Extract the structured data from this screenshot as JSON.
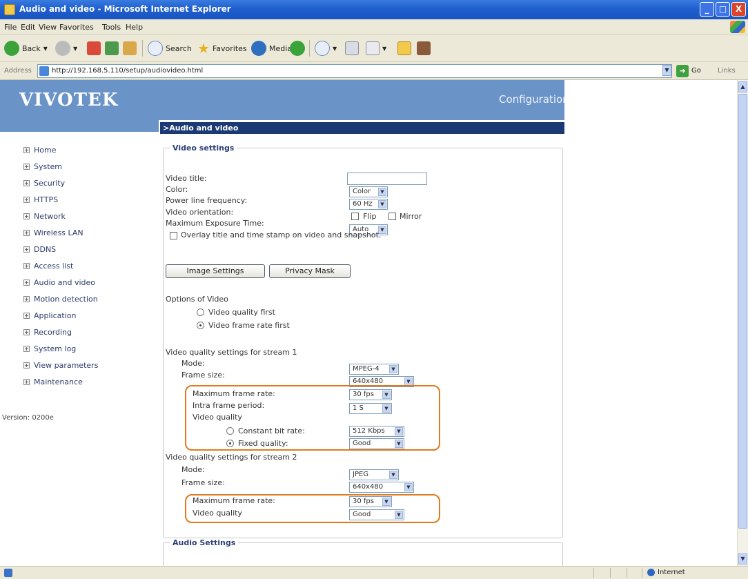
{
  "window": {
    "title": "Audio and video - Microsoft Internet Explorer",
    "min": "_",
    "max": "□",
    "close": "X"
  },
  "menu": [
    "File",
    "Edit",
    "View",
    "Favorites",
    "Tools",
    "Help"
  ],
  "toolbar": {
    "back": "Back",
    "search": "Search",
    "favorites": "Favorites",
    "media": "Media"
  },
  "address": {
    "label": "Address",
    "url": "http://192.168.5.110/setup/audiovideo.html",
    "go": "Go",
    "links": "Links"
  },
  "brand": {
    "logo": "VIVOTEK",
    "config": "Configuration"
  },
  "section_title": "Audio and video",
  "sidebar": {
    "items": [
      "Home",
      "System",
      "Security",
      "HTTPS",
      "Network",
      "Wireless LAN",
      "DDNS",
      "Access list",
      "Audio and video",
      "Motion detection",
      "Application",
      "Recording",
      "System log",
      "View parameters",
      "Maintenance"
    ],
    "version": "Version: 0200e"
  },
  "video_settings": {
    "legend": "Video settings",
    "video_title_label": "Video title:",
    "video_title_value": "",
    "color_label": "Color:",
    "color_value": "Color",
    "power_label": "Power line frequency:",
    "power_value": "60 Hz",
    "orientation_label": "Video orientation:",
    "flip_label": "Flip",
    "mirror_label": "Mirror",
    "exposure_label": "Maximum Exposure Time:",
    "exposure_value": "Auto",
    "overlay_label": "Overlay title and time stamp on video and snapshot.",
    "image_settings_btn": "Image Settings",
    "privacy_mask_btn": "Privacy Mask",
    "options_label": "Options of Video",
    "opt_quality_first": "Video quality first",
    "opt_framerate_first": "Video frame rate first"
  },
  "stream1": {
    "heading": "Video quality settings for stream 1",
    "mode_label": "Mode:",
    "mode_value": "MPEG-4",
    "frame_size_label": "Frame size:",
    "frame_size_value": "640x480",
    "max_frame_rate_label": "Maximum frame rate:",
    "max_frame_rate_value": "30 fps",
    "intra_label": "Intra frame period:",
    "intra_value": "1 S",
    "quality_label": "Video quality",
    "cbr_label": "Constant bit rate:",
    "cbr_value": "512 Kbps",
    "fixed_label": "Fixed quality:",
    "fixed_value": "Good"
  },
  "stream2": {
    "heading": "Video quality settings for stream 2",
    "mode_label": "Mode:",
    "mode_value": "JPEG",
    "frame_size_label": "Frame size:",
    "frame_size_value": "640x480",
    "max_frame_rate_label": "Maximum frame rate:",
    "max_frame_rate_value": "30 fps",
    "quality_label": "Video quality",
    "quality_value": "Good"
  },
  "audio_settings": {
    "legend": "Audio Settings"
  },
  "status": {
    "zone": "Internet"
  },
  "colors": {
    "header_blue": "#6a93c8",
    "section_navy": "#1b3a73",
    "highlight": "#e07a1c"
  }
}
